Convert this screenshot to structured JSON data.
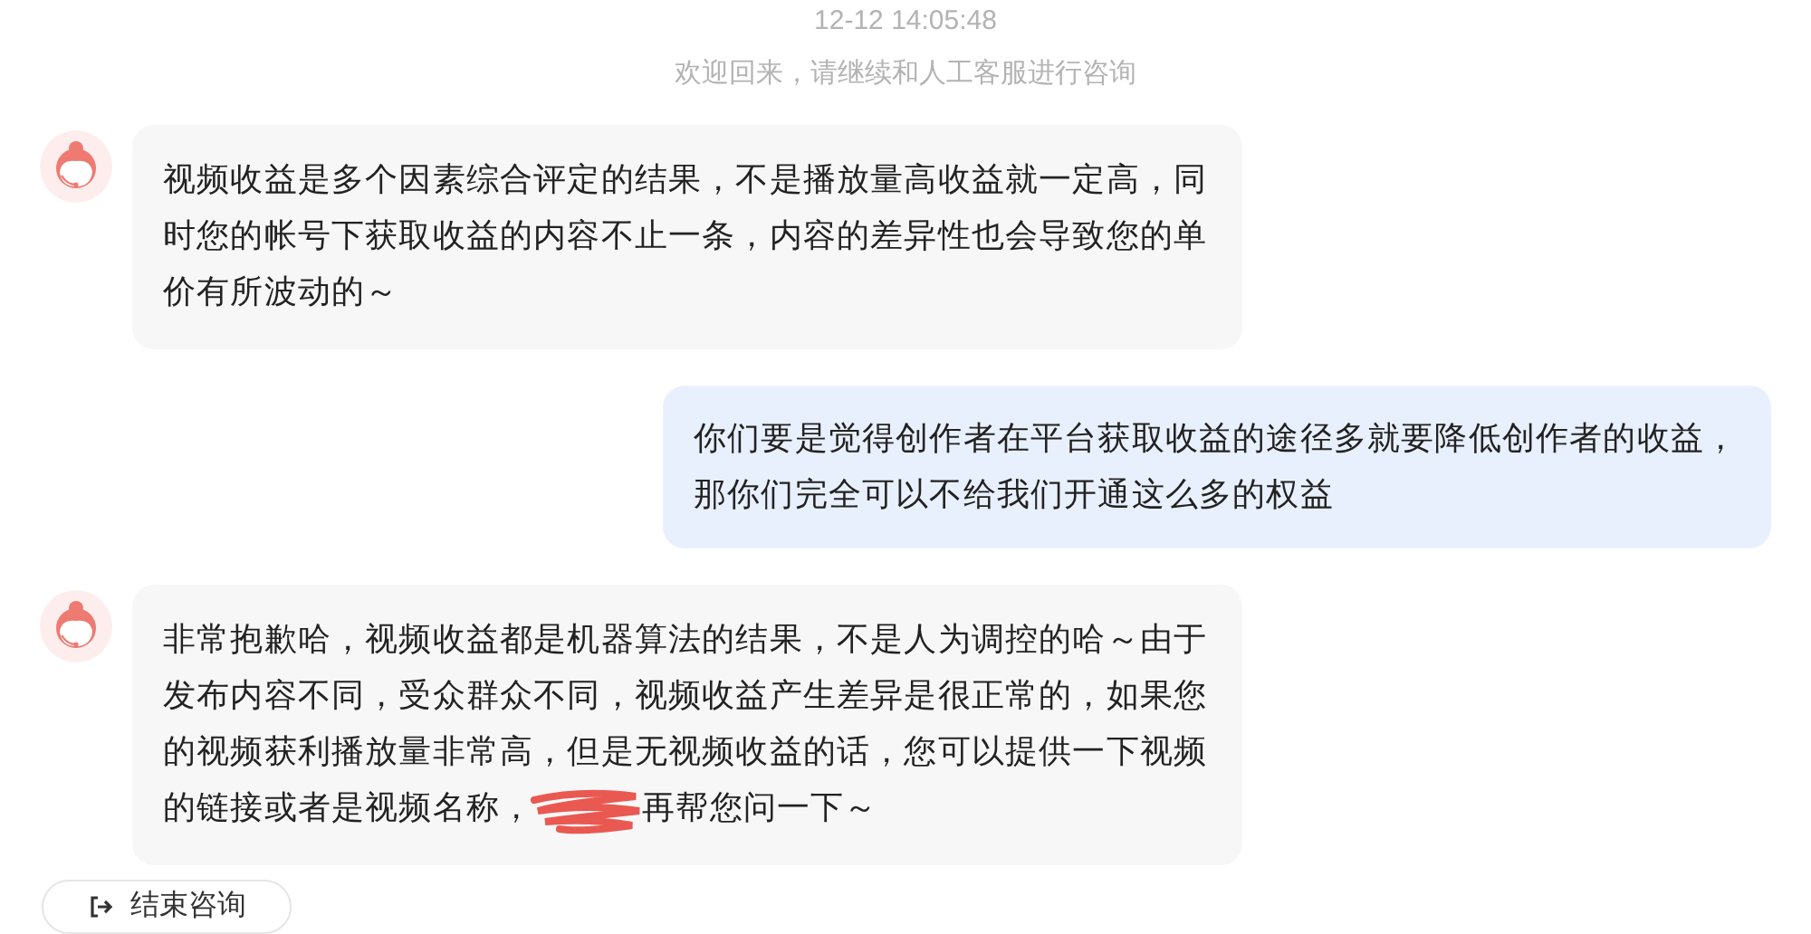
{
  "timestamp": "12-12 14:05:48",
  "notice": "欢迎回来，请继续和人工客服进行咨询",
  "messages": [
    {
      "kind": "agent",
      "text": "视频收益是多个因素综合评定的结果，不是播放量高收益就一定高，同时您的帐号下获取收益的内容不止一条，内容的差异性也会导致您的单价有所波动的～"
    },
    {
      "kind": "user",
      "text": "你们要是觉得创作者在平台获取收益的途径多就要降低创作者的收益，那你们完全可以不给我们开通这么多的权益"
    },
    {
      "kind": "agent",
      "text": "非常抱歉哈，视频收益都是机器算法的结果，不是人为调控的哈～由于发布内容不同，受众群众不同，视频收益产生差异是很正常的，如果您的视频获利播放量非常高，但是无视频收益的话，您可以提供一下视频的链接或者是视频名称，",
      "text_after_redaction": "再帮您问一下～"
    }
  ],
  "end_button": "结束咨询"
}
